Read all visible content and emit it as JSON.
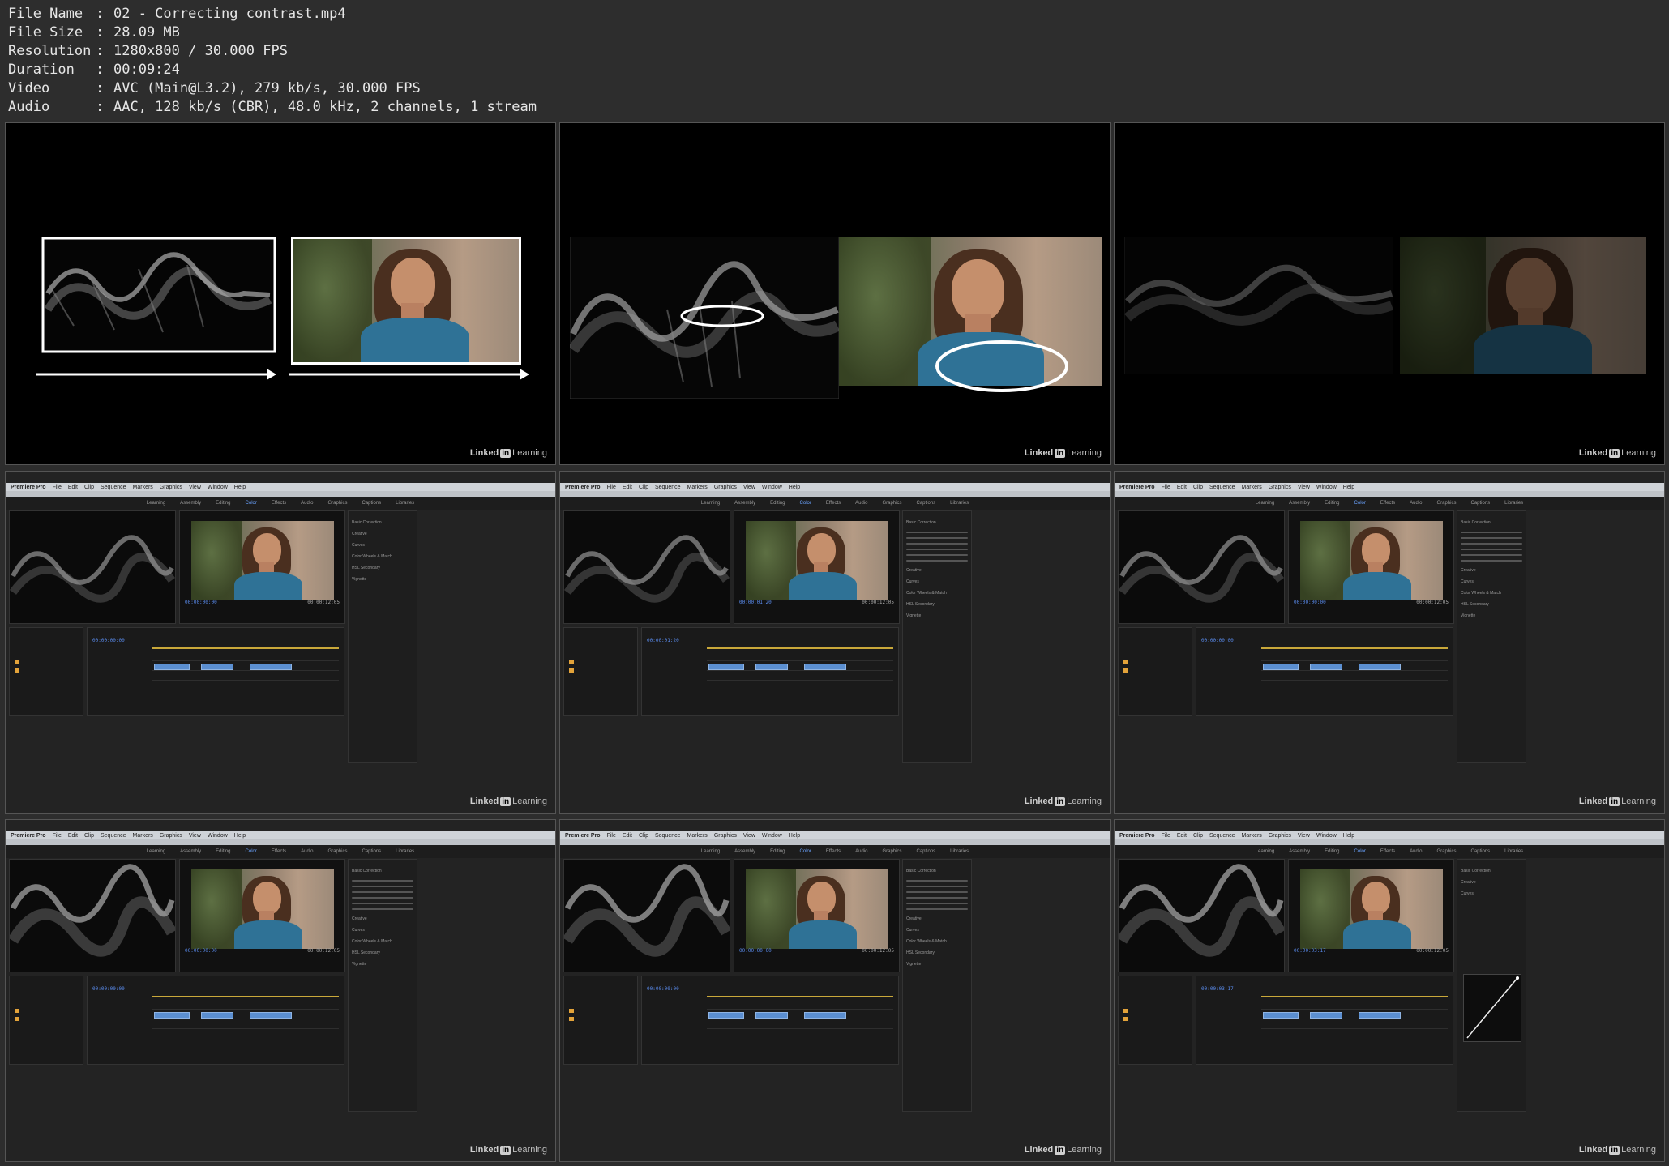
{
  "file_info": [
    {
      "key": "File Name",
      "value": "02 - Correcting contrast.mp4"
    },
    {
      "key": "File Size",
      "value": "28.09 MB"
    },
    {
      "key": "Resolution",
      "value": "1280x800 / 30.000 FPS"
    },
    {
      "key": "Duration",
      "value": "00:09:24"
    },
    {
      "key": "Video",
      "value": "AVC (Main@L3.2), 279 kb/s, 30.000 FPS"
    },
    {
      "key": "Audio",
      "value": "AAC, 128 kb/s (CBR), 48.0 kHz, 2 channels, 1 stream"
    }
  ],
  "separator": ":",
  "watermark": {
    "brand": "Linked",
    "in": "in",
    "suffix": "Learning"
  },
  "premiere": {
    "app": "Premiere Pro",
    "menu": [
      "File",
      "Edit",
      "Clip",
      "Sequence",
      "Markers",
      "Graphics",
      "View",
      "Window",
      "Help"
    ],
    "workspaces": [
      "Learning",
      "Assembly",
      "Editing",
      "Color",
      "Effects",
      "Audio",
      "Graphics",
      "Captions",
      "Libraries"
    ],
    "lumetri_sections": [
      "Basic Correction",
      "Creative",
      "Curves",
      "Color Wheels & Match",
      "HSL Secondary",
      "Vignette"
    ],
    "timecodes": {
      "r1c0": "00:00:00:00",
      "r1c1": "00:00:01:20",
      "r1c2": "00:00:00:00",
      "r2c0": "00:00:00:00",
      "r2c1": "00:00:00:00",
      "r2c2": "00:00:03:17"
    },
    "duration": "00:00:12:05"
  },
  "colors": {
    "accent": "#5b8df0",
    "clip": "#5b8fd1",
    "bin": "#e3a33a",
    "shirt": "#2f7296"
  }
}
